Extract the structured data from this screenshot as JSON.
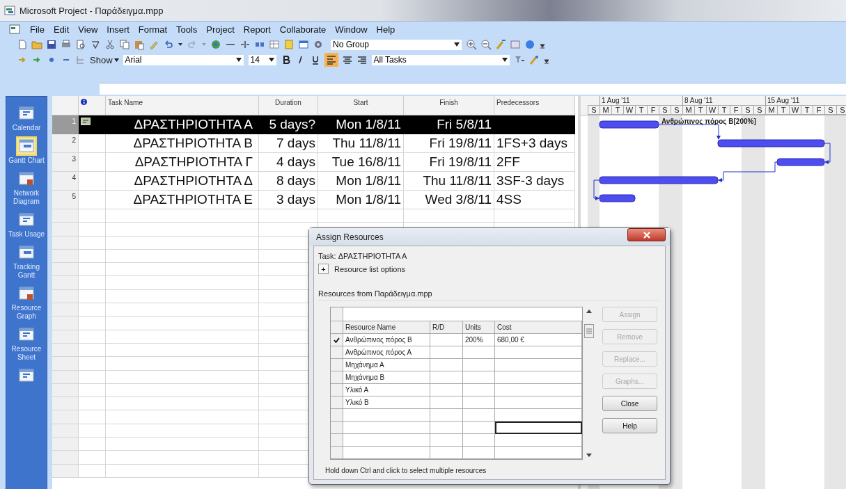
{
  "window": {
    "title": "Microsoft Project - Παράδειγμα.mpp"
  },
  "menu": [
    "File",
    "Edit",
    "View",
    "Insert",
    "Format",
    "Tools",
    "Project",
    "Report",
    "Collaborate",
    "Window",
    "Help"
  ],
  "toolbar": {
    "group": "No Group",
    "show": "Show",
    "font": "Arial",
    "size": "14",
    "filter": "All Tasks"
  },
  "view_bar": [
    {
      "label": "Calendar",
      "selected": false
    },
    {
      "label": "Gantt Chart",
      "selected": true
    },
    {
      "label": "Network Diagram",
      "selected": false
    },
    {
      "label": "Task Usage",
      "selected": false
    },
    {
      "label": "Tracking Gantt",
      "selected": false
    },
    {
      "label": "Resource Graph",
      "selected": false
    },
    {
      "label": "Resource Sheet",
      "selected": false
    }
  ],
  "table": {
    "columns": [
      "Task Name",
      "Duration",
      "Start",
      "Finish",
      "Predecessors"
    ],
    "rows": [
      {
        "id": "1",
        "indicator": true,
        "name": "ΔΡΑΣΤΗΡΙΟΤΗΤΑ Α",
        "duration": "5 days?",
        "start": "Mon 1/8/11",
        "finish": "Fri 5/8/11",
        "selected": true
      },
      {
        "id": "2",
        "indicator": false,
        "name": "ΔΡΑΣΤΗΡΙΟΤΗΤΑ Β",
        "duration": "7 days",
        "start": "Thu 11/8/11",
        "finish": "Fri 19/8/11",
        "predecessors": "1FS+3 days",
        "selected": false
      },
      {
        "id": "3",
        "indicator": false,
        "name": "ΔΡΑΣΤΗΡΙΟΤΗΤΑ Γ",
        "duration": "4 days",
        "start": "Tue 16/8/11",
        "finish": "Fri 19/8/11",
        "predecessors": "2FF",
        "selected": false
      },
      {
        "id": "4",
        "indicator": false,
        "name": "ΔΡΑΣΤΗΡΙΟΤΗΤΑ Δ",
        "duration": "8 days",
        "start": "Mon 1/8/11",
        "finish": "Thu 11/8/11",
        "predecessors": "3SF-3 days",
        "selected": false
      },
      {
        "id": "5",
        "indicator": false,
        "name": "ΔΡΑΣΤΗΡΙΟΤΗΤΑ Ε",
        "duration": "3 days",
        "start": "Mon 1/8/11",
        "finish": "Wed 3/8/11",
        "predecessors": "4SS",
        "selected": false
      }
    ]
  },
  "gantt": {
    "weeks": [
      "1 Aug '11",
      "8 Aug '11",
      "15 Aug '11"
    ],
    "days": [
      "S",
      "M",
      "T",
      "W",
      "T",
      "F",
      "S",
      "S",
      "M",
      "T",
      "W",
      "T",
      "F",
      "S",
      "S",
      "M",
      "T",
      "W",
      "T",
      "F",
      "S",
      "S"
    ],
    "bar_label": "Ανθρώπινος πόρος Β[200%]"
  },
  "dialog": {
    "title": "Assign Resources",
    "task": "Task: ΔΡΑΣΤΗΡΙΟΤΗΤΑ Α",
    "expand_button": "+",
    "options_label": "Resource list options",
    "section": "Resources from Παράδειγμα.mpp",
    "columns": [
      "Resource Name",
      "R/D",
      "Units",
      "Cost"
    ],
    "resources": [
      {
        "name": "Ανθρώπινος πόρος Β",
        "assigned": true,
        "units": "200%",
        "cost": "680,00 €"
      },
      {
        "name": "Ανθρώπινος πόρος Α",
        "assigned": false
      },
      {
        "name": "Μηχάνημα Α",
        "assigned": false
      },
      {
        "name": "Μηχάνημα Β",
        "assigned": false
      },
      {
        "name": "Υλικό Α",
        "assigned": false
      },
      {
        "name": "Υλικό Β",
        "assigned": false
      }
    ],
    "buttons": [
      {
        "label": "Assign",
        "disabled": true
      },
      {
        "label": "Remove",
        "disabled": true
      },
      {
        "label": "Replace...",
        "disabled": true
      },
      {
        "label": "Graphs...",
        "disabled": true
      },
      {
        "label": "Close",
        "disabled": false
      },
      {
        "label": "Help",
        "disabled": false
      }
    ],
    "hint": "Hold down Ctrl and click to select multiple resources"
  }
}
